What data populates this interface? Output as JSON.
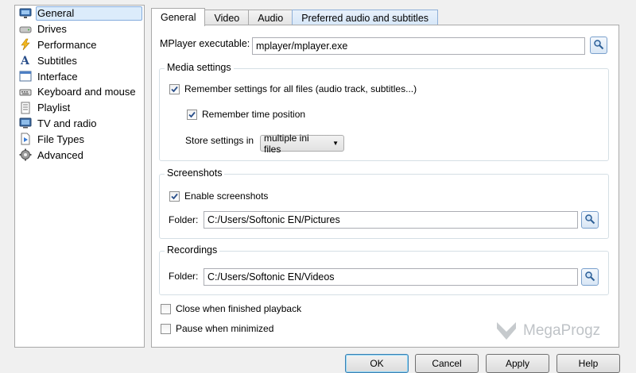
{
  "sidebar": {
    "items": [
      {
        "label": "General",
        "icon": "monitor-icon",
        "selected": true
      },
      {
        "label": "Drives",
        "icon": "drive-icon"
      },
      {
        "label": "Performance",
        "icon": "lightning-icon"
      },
      {
        "label": "Subtitles",
        "icon": "subtitles-icon"
      },
      {
        "label": "Interface",
        "icon": "interface-icon"
      },
      {
        "label": "Keyboard and mouse",
        "icon": "keyboard-icon"
      },
      {
        "label": "Playlist",
        "icon": "playlist-icon"
      },
      {
        "label": "TV and radio",
        "icon": "tv-icon"
      },
      {
        "label": "File Types",
        "icon": "file-types-icon"
      },
      {
        "label": "Advanced",
        "icon": "gear-icon"
      }
    ]
  },
  "tabs": [
    {
      "label": "General",
      "active": true
    },
    {
      "label": "Video"
    },
    {
      "label": "Audio"
    },
    {
      "label": "Preferred audio and subtitles"
    }
  ],
  "general": {
    "mplayer_label": "MPlayer executable:",
    "mplayer_value": "mplayer/mplayer.exe",
    "media": {
      "title": "Media settings",
      "remember_all": "Remember settings for all files (audio track, subtitles...)",
      "remember_time": "Remember time position",
      "store_label": "Store settings in",
      "store_value": "multiple ini files"
    },
    "screenshots": {
      "title": "Screenshots",
      "enable": "Enable screenshots",
      "folder_label": "Folder:",
      "folder_value": "C:/Users/Softonic EN/Pictures"
    },
    "recordings": {
      "title": "Recordings",
      "folder_label": "Folder:",
      "folder_value": "C:/Users/Softonic EN/Videos"
    },
    "close_when_finished": "Close when finished playback",
    "pause_when_minimized": "Pause when minimized"
  },
  "buttons": {
    "ok": "OK",
    "cancel": "Cancel",
    "apply": "Apply",
    "help": "Help"
  },
  "watermark": "MegaProgz",
  "colors": {
    "selection": "#dcecfb",
    "selection_border": "#84acdd",
    "tab_blue": "#d5e6f8"
  }
}
